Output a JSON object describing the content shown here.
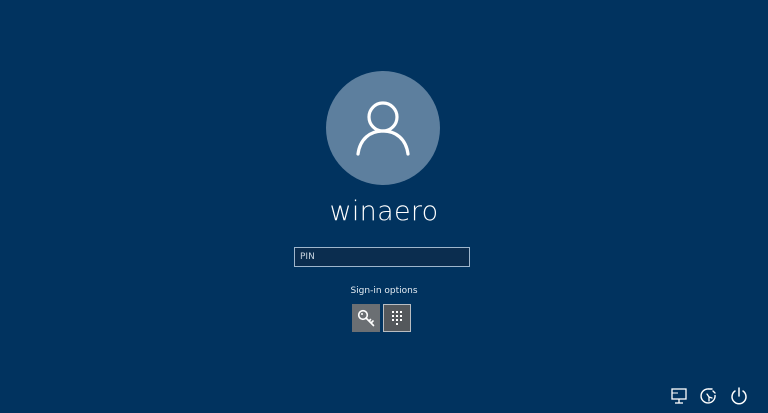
{
  "user": {
    "name": "winaero"
  },
  "pin_field": {
    "placeholder": "PIN",
    "value": ""
  },
  "signin": {
    "label": "Sign-in options",
    "options": [
      {
        "name": "password",
        "icon": "key-icon",
        "selected": false
      },
      {
        "name": "pin",
        "icon": "keypad-icon",
        "selected": true
      }
    ]
  },
  "tray": {
    "icons": [
      "network-icon",
      "ease-of-access-icon",
      "power-icon"
    ]
  },
  "colors": {
    "background": "#01335f",
    "avatar": "#5d7f9e"
  }
}
